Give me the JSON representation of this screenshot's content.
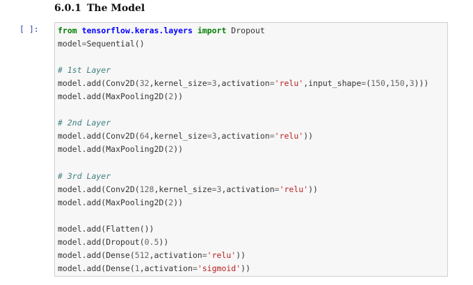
{
  "heading": {
    "number": "6.0.1",
    "title": "The Model"
  },
  "cell": {
    "prompt": "[ ]:",
    "lines": [
      [
        {
          "t": "from",
          "c": "kw"
        },
        {
          "t": " "
        },
        {
          "t": "tensorflow.keras.layers",
          "c": "mod"
        },
        {
          "t": " "
        },
        {
          "t": "import",
          "c": "kw"
        },
        {
          "t": " Dropout"
        }
      ],
      [
        {
          "t": "model"
        },
        {
          "t": "=",
          "c": "op"
        },
        {
          "t": "Sequential()"
        }
      ],
      [],
      [
        {
          "t": "# 1st Layer",
          "c": "cm"
        }
      ],
      [
        {
          "t": "model.add(Conv2D("
        },
        {
          "t": "32",
          "c": "num-lit"
        },
        {
          "t": ",kernel_size"
        },
        {
          "t": "=",
          "c": "op"
        },
        {
          "t": "3",
          "c": "num-lit"
        },
        {
          "t": ",activation"
        },
        {
          "t": "=",
          "c": "op"
        },
        {
          "t": "'relu'",
          "c": "str"
        },
        {
          "t": ",input_shape"
        },
        {
          "t": "=",
          "c": "op"
        },
        {
          "t": "("
        },
        {
          "t": "150",
          "c": "num-lit"
        },
        {
          "t": ","
        },
        {
          "t": "150",
          "c": "num-lit"
        },
        {
          "t": ","
        },
        {
          "t": "3",
          "c": "num-lit"
        },
        {
          "t": ")))"
        }
      ],
      [
        {
          "t": "model.add(MaxPooling2D("
        },
        {
          "t": "2",
          "c": "num-lit"
        },
        {
          "t": "))"
        }
      ],
      [],
      [
        {
          "t": "# 2nd Layer",
          "c": "cm"
        }
      ],
      [
        {
          "t": "model.add(Conv2D("
        },
        {
          "t": "64",
          "c": "num-lit"
        },
        {
          "t": ",kernel_size"
        },
        {
          "t": "=",
          "c": "op"
        },
        {
          "t": "3",
          "c": "num-lit"
        },
        {
          "t": ",activation"
        },
        {
          "t": "=",
          "c": "op"
        },
        {
          "t": "'relu'",
          "c": "str"
        },
        {
          "t": "))"
        }
      ],
      [
        {
          "t": "model.add(MaxPooling2D("
        },
        {
          "t": "2",
          "c": "num-lit"
        },
        {
          "t": "))"
        }
      ],
      [],
      [
        {
          "t": "# 3rd Layer",
          "c": "cm"
        }
      ],
      [
        {
          "t": "model.add(Conv2D("
        },
        {
          "t": "128",
          "c": "num-lit"
        },
        {
          "t": ",kernel_size"
        },
        {
          "t": "=",
          "c": "op"
        },
        {
          "t": "3",
          "c": "num-lit"
        },
        {
          "t": ",activation"
        },
        {
          "t": "=",
          "c": "op"
        },
        {
          "t": "'relu'",
          "c": "str"
        },
        {
          "t": "))"
        }
      ],
      [
        {
          "t": "model.add(MaxPooling2D("
        },
        {
          "t": "2",
          "c": "num-lit"
        },
        {
          "t": "))"
        }
      ],
      [],
      [
        {
          "t": "model.add(Flatten())"
        }
      ],
      [
        {
          "t": "model.add(Dropout("
        },
        {
          "t": "0.5",
          "c": "num-lit"
        },
        {
          "t": "))"
        }
      ],
      [
        {
          "t": "model.add(Dense("
        },
        {
          "t": "512",
          "c": "num-lit"
        },
        {
          "t": ",activation"
        },
        {
          "t": "=",
          "c": "op"
        },
        {
          "t": "'relu'",
          "c": "str"
        },
        {
          "t": "))"
        }
      ],
      [
        {
          "t": "model.add(Dense("
        },
        {
          "t": "1",
          "c": "num-lit"
        },
        {
          "t": ",activation"
        },
        {
          "t": "=",
          "c": "op"
        },
        {
          "t": "'sigmoid'",
          "c": "str"
        },
        {
          "t": "))"
        }
      ]
    ]
  },
  "colors": {
    "prompt": "#303f9f",
    "cell_background": "#f7f7f7",
    "cell_border": "#cfcfcf",
    "keyword": "#008000",
    "string": "#ba2121",
    "comment": "#408080"
  }
}
